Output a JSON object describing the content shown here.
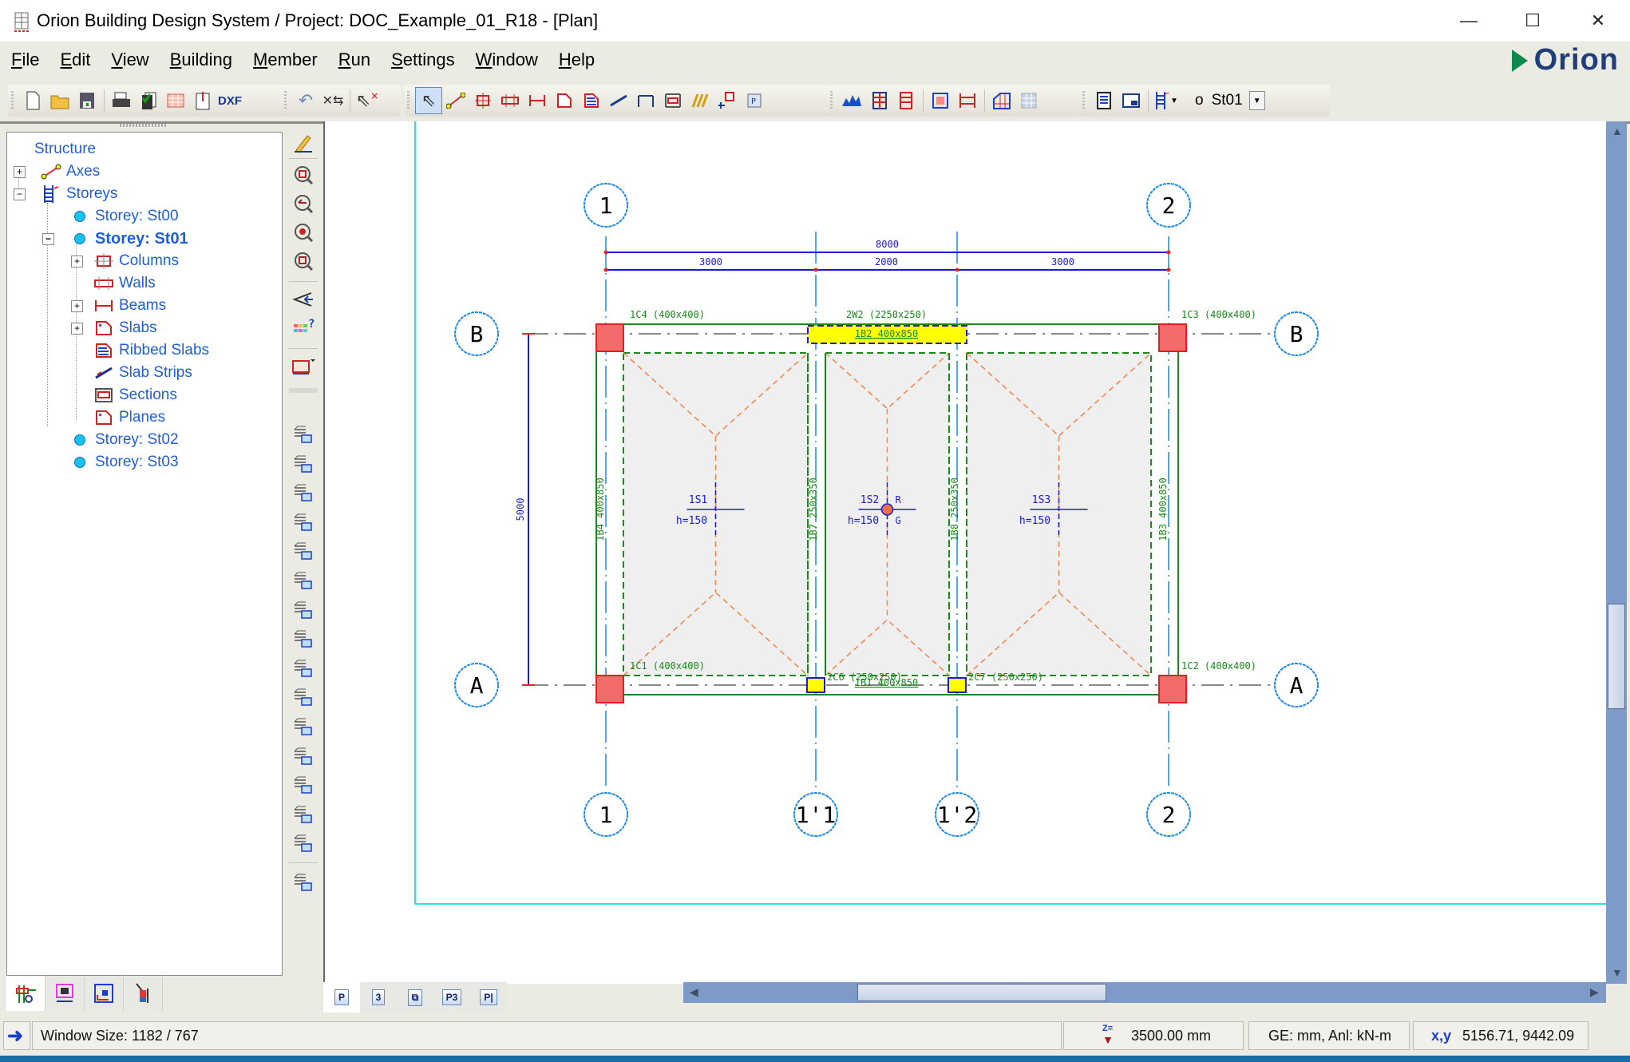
{
  "window": {
    "title": "Orion Building Design System / Project: DOC_Example_01_R18 - [Plan]",
    "controls": {
      "minimize": "—",
      "maximize": "☐",
      "close": "✕"
    }
  },
  "menu": [
    {
      "label": "File",
      "accel": "F",
      "rest": "ile"
    },
    {
      "label": "Edit",
      "accel": "E",
      "rest": "dit"
    },
    {
      "label": "View",
      "accel": "V",
      "rest": "iew"
    },
    {
      "label": "Building",
      "accel": "B",
      "rest": "uilding"
    },
    {
      "label": "Member",
      "accel": "M",
      "rest": "ember"
    },
    {
      "label": "Run",
      "accel": "R",
      "rest": "un"
    },
    {
      "label": "Settings",
      "accel": "S",
      "rest": "ettings"
    },
    {
      "label": "Window",
      "accel": "W",
      "rest": "indow"
    },
    {
      "label": "Help",
      "accel": "H",
      "rest": "elp"
    }
  ],
  "brand": {
    "name": "Orion",
    "accent": "#0e8a4c",
    "color": "#1e3f7a"
  },
  "toolbar": {
    "file_group": [
      "new-file-icon",
      "open-folder-icon",
      "save-icon",
      "print-icon",
      "copy-check-icon",
      "table-icon",
      "export-icon",
      "dxf-icon"
    ],
    "edit_group": [
      "undo-icon",
      "move-node-icon",
      "delete-select-icon"
    ],
    "member_group": [
      "pointer-icon",
      "axis-icon",
      "column-icon",
      "wall-icon",
      "beam-icon",
      "slab-icon",
      "ribbed-slab-icon",
      "slab-strip-icon",
      "dimension-icon",
      "section-icon",
      "stair-icon",
      "node-icon",
      "plane-icon"
    ],
    "analysis_group": [
      "loads-icon",
      "frame-icon",
      "storey-frame-icon",
      "column-design-icon",
      "beam-design-icon",
      "mesh-3d-icon",
      "grid-icon"
    ],
    "view_group": [
      "report-icon",
      "window-icon",
      "storey-select-icon"
    ],
    "storey_selector": {
      "prefix": "o",
      "value": "St01"
    }
  },
  "tree": {
    "root": "Structure",
    "items": [
      {
        "label": "Axes",
        "level": 1,
        "expander": "+",
        "icon": "axes-icon"
      },
      {
        "label": "Storeys",
        "level": 1,
        "expander": "−",
        "icon": "storeys-icon"
      },
      {
        "label": "Storey: St00",
        "level": 2,
        "icon": "storey-dot-icon"
      },
      {
        "label": "Storey: St01",
        "level": 2,
        "expander": "−",
        "icon": "storey-dot-icon",
        "selected": true
      },
      {
        "label": "Columns",
        "level": 3,
        "expander": "+",
        "icon": "columns-icon"
      },
      {
        "label": "Walls",
        "level": 3,
        "icon": "walls-icon"
      },
      {
        "label": "Beams",
        "level": 3,
        "expander": "+",
        "icon": "beams-icon"
      },
      {
        "label": "Slabs",
        "level": 3,
        "expander": "+",
        "icon": "slabs-icon"
      },
      {
        "label": "Ribbed Slabs",
        "level": 3,
        "icon": "ribbed-slabs-icon"
      },
      {
        "label": "Slab Strips",
        "level": 3,
        "icon": "slab-strips-icon"
      },
      {
        "label": "Sections",
        "level": 3,
        "icon": "sections-icon"
      },
      {
        "label": "Planes",
        "level": 3,
        "icon": "planes-icon"
      },
      {
        "label": "Storey: St02",
        "level": 2,
        "icon": "storey-dot-icon"
      },
      {
        "label": "Storey: St03",
        "level": 2,
        "icon": "storey-dot-icon"
      }
    ]
  },
  "left_tabs": [
    "structure-tab-icon",
    "member-tab-icon",
    "design-tab-icon",
    "drafting-tab-icon"
  ],
  "view_tabs": [
    {
      "label": "P",
      "active": true
    },
    {
      "label": "3"
    },
    {
      "label": "⧉"
    },
    {
      "label": "P3"
    },
    {
      "label": "P|"
    }
  ],
  "plan": {
    "axes_x": [
      {
        "label": "1",
        "top_bubble": true,
        "bottom_bubble": true
      },
      {
        "label": "1'1",
        "top_bubble": false,
        "bottom_bubble": true
      },
      {
        "label": "1'2",
        "top_bubble": false,
        "bottom_bubble": true
      },
      {
        "label": "2",
        "top_bubble": true,
        "bottom_bubble": true
      }
    ],
    "axes_y": [
      {
        "label": "B"
      },
      {
        "label": "A"
      }
    ],
    "dimensions": {
      "total": "8000",
      "spans": [
        "3000",
        "2000",
        "3000"
      ],
      "vertical": "5000"
    },
    "columns": [
      {
        "label": "1C4 (400x400)"
      },
      {
        "label": "1C3 (400x400)"
      },
      {
        "label": "1C1 (400x400)"
      },
      {
        "label": "1C2 (400x400)"
      },
      {
        "label": "2C6 (250x250)"
      },
      {
        "label": "2C7 (250x250)"
      }
    ],
    "walls": [
      {
        "label": "2W2 (2250x250)"
      }
    ],
    "beams": [
      {
        "label": "1B2 400x850"
      },
      {
        "label": "1B1 400x850"
      },
      {
        "label": "1B4 400x850"
      },
      {
        "label": "1B7 250x350"
      },
      {
        "label": "1B8 250x350"
      },
      {
        "label": "1B3 400x850"
      }
    ],
    "slabs": [
      {
        "label": "1S1",
        "thickness": "h=150"
      },
      {
        "label": "1S2",
        "thickness": "h=150",
        "marks": [
          "R",
          "G"
        ]
      },
      {
        "label": "1S3",
        "thickness": "h=150"
      }
    ],
    "colors": {
      "axis": "#1e88e5",
      "column": "#f36b6b",
      "beam": "#1a8a1a",
      "dimension": "#1b1bd0",
      "wall": "#ffff00",
      "yield_line": "#f2844a",
      "frame": "#22e5e5"
    }
  },
  "status": {
    "message": "Window Size: 1182 / 767",
    "elevation": "3500.00 mm",
    "elevation_label": "Z=",
    "units": "GE: mm, Anl: kN-m",
    "coords_label": "x,y",
    "coords": "5156.71, 9442.09"
  }
}
